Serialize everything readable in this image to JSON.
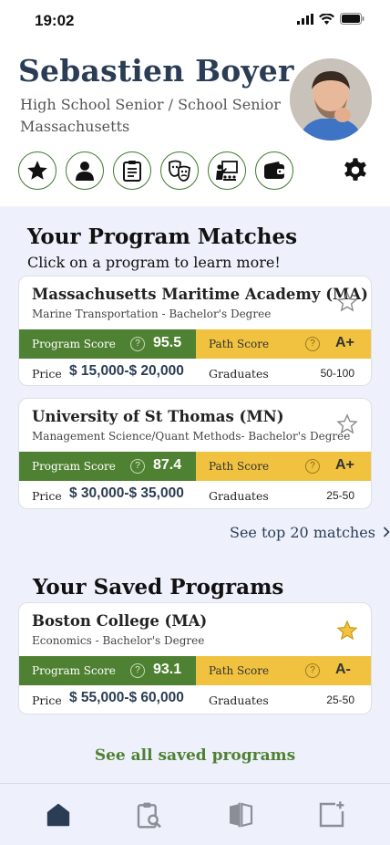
{
  "status": {
    "time": "19:02"
  },
  "profile": {
    "name": "Sebastien Boyer",
    "line1": "High School Senior /  School Senior",
    "line2": "Massachusetts"
  },
  "header_icons": [
    "star-icon",
    "person-icon",
    "clipboard-icon",
    "theater-masks-icon",
    "teacher-board-icon",
    "wallet-icon"
  ],
  "settings_icon": "gear-icon",
  "matches": {
    "title": "Your Program Matches",
    "subtitle": "Click on a program to learn more!",
    "see_more": "See top 20 matches",
    "items": [
      {
        "name": "Massachusetts Maritime Academy (MA)",
        "desc": "Marine Transportation - Bachelor's Degree",
        "program_score_label": "Program Score",
        "program_score": "95.5",
        "path_score_label": "Path Score",
        "path_score": "A+",
        "price_label": "Price",
        "price": "$ 15,000-$ 20,000",
        "graduates_label": "Graduates",
        "graduates": "50-100",
        "saved": false
      },
      {
        "name": "University of St Thomas (MN)",
        "desc": "Management Science/Quant Methods- Bachelor's Degree",
        "program_score_label": "Program Score",
        "program_score": "87.4",
        "path_score_label": "Path Score",
        "path_score": "A+",
        "price_label": "Price",
        "price": "$ 30,000-$ 35,000",
        "graduates_label": "Graduates",
        "graduates": "25-50",
        "saved": false
      }
    ]
  },
  "saved": {
    "title": "Your Saved Programs",
    "see_all": "See all saved programs",
    "items": [
      {
        "name": "Boston College (MA)",
        "desc": "Economics - Bachelor's Degree",
        "program_score_label": "Program Score",
        "program_score": "93.1",
        "path_score_label": "Path Score",
        "path_score": "A-",
        "price_label": "Price",
        "price": "$ 55,000-$ 60,000",
        "graduates_label": "Graduates",
        "graduates": "25-50",
        "saved": true
      }
    ]
  },
  "tabs": [
    {
      "icon": "home-icon",
      "active": true
    },
    {
      "icon": "clipboard-search-icon",
      "active": false
    },
    {
      "icon": "compare-icon",
      "active": false
    },
    {
      "icon": "add-note-icon",
      "active": false
    }
  ],
  "colors": {
    "green": "#4f8132",
    "gold": "#f0c23f",
    "navy": "#2b3d55",
    "background": "#eef1fb"
  }
}
